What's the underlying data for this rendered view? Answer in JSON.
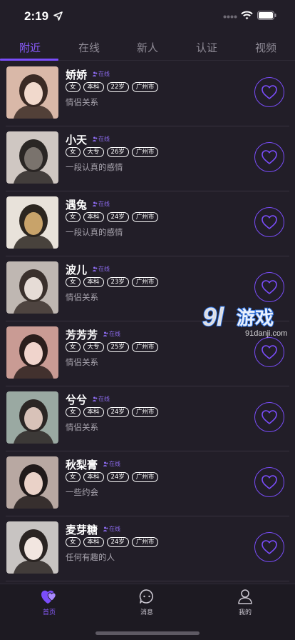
{
  "status_bar": {
    "time": "2:19"
  },
  "tabs": [
    {
      "label": "附近",
      "active": true
    },
    {
      "label": "在线",
      "active": false
    },
    {
      "label": "新人",
      "active": false
    },
    {
      "label": "认证",
      "active": false
    },
    {
      "label": "视频",
      "active": false
    }
  ],
  "users": [
    {
      "name": "娇娇",
      "online": "在线",
      "tags": [
        "女",
        "本科",
        "22岁",
        "广州市"
      ],
      "desc": "情侣关系"
    },
    {
      "name": "小天",
      "online": "在线",
      "tags": [
        "女",
        "大专",
        "26岁",
        "广州市"
      ],
      "desc": "一段认真的感情"
    },
    {
      "name": "遇兔",
      "online": "在线",
      "tags": [
        "女",
        "本科",
        "24岁",
        "广州市"
      ],
      "desc": "一段认真的感情"
    },
    {
      "name": "波儿",
      "online": "在线",
      "tags": [
        "女",
        "本科",
        "23岁",
        "广州市"
      ],
      "desc": "情侣关系"
    },
    {
      "name": "芳芳芳",
      "online": "在线",
      "tags": [
        "女",
        "大专",
        "25岁",
        "广州市"
      ],
      "desc": "情侣关系"
    },
    {
      "name": "兮兮",
      "online": "在线",
      "tags": [
        "女",
        "本科",
        "24岁",
        "广州市"
      ],
      "desc": "情侣关系"
    },
    {
      "name": "秋梨膏",
      "online": "在线",
      "tags": [
        "女",
        "本科",
        "24岁",
        "广州市"
      ],
      "desc": "一些约会"
    },
    {
      "name": "麦芽糖",
      "online": "在线",
      "tags": [
        "女",
        "本科",
        "24岁",
        "广州市"
      ],
      "desc": "任何有趣的人"
    }
  ],
  "watermark": {
    "logo": "9l游戏",
    "site": "91danji.com"
  },
  "bottom_nav": {
    "home": "首页",
    "messages": "消息",
    "profile": "我的"
  },
  "colors": {
    "accent": "#7a4dfa",
    "background": "#221e28",
    "online": "#8e6cf2"
  }
}
